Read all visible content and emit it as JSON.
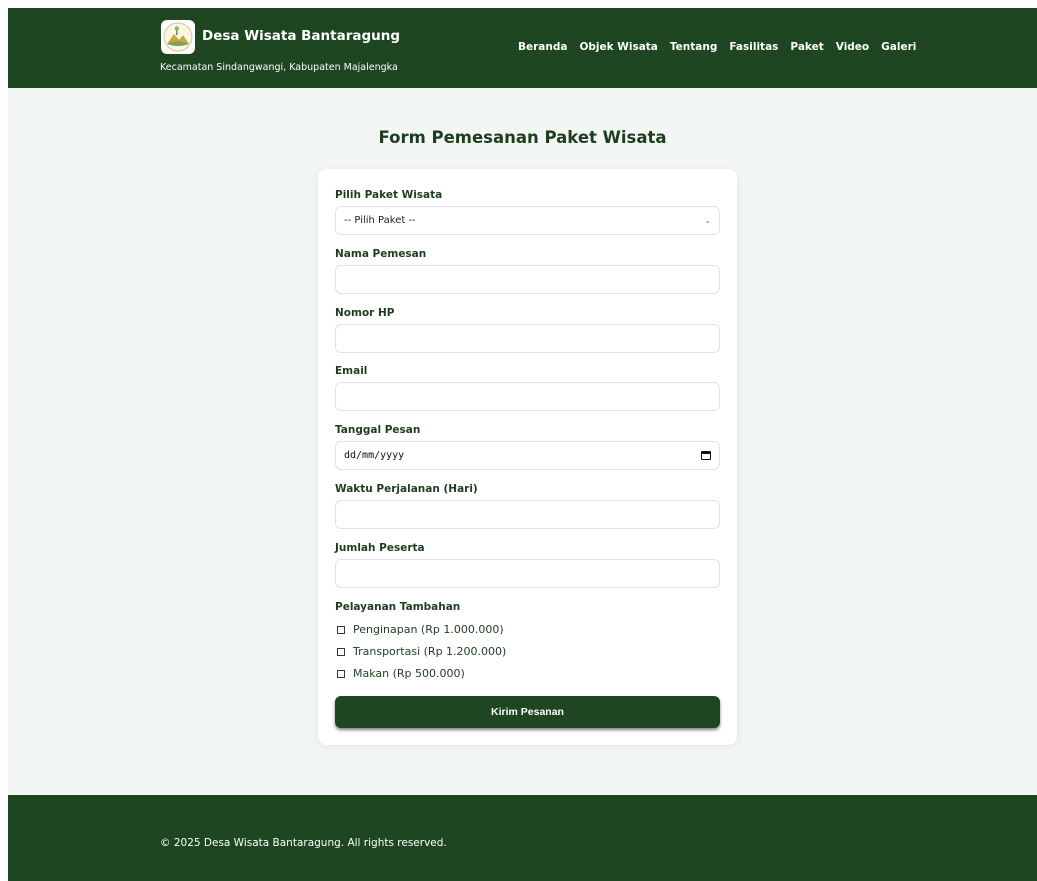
{
  "header": {
    "brand_title": "Desa Wisata Bantaragung",
    "brand_subtitle": "Kecamatan Sindangwangi, Kabupaten Majalengka",
    "nav": [
      "Beranda",
      "Objek Wisata",
      "Tentang",
      "Fasilitas",
      "Paket",
      "Video",
      "Galeri"
    ]
  },
  "form": {
    "title": "Form Pemesanan Paket Wisata",
    "paket_label": "Pilih Paket Wisata",
    "paket_selected": "-- Pilih Paket --",
    "nama_label": "Nama Pemesan",
    "nama_value": "",
    "hp_label": "Nomor HP",
    "hp_value": "",
    "email_label": "Email",
    "email_value": "",
    "tanggal_label": "Tanggal Pesan",
    "tanggal_placeholder": "dd/mm/yyyy",
    "waktu_label": "Waktu Perjalanan (Hari)",
    "waktu_value": "",
    "jumlah_label": "Jumlah Peserta",
    "jumlah_value": "",
    "layanan_label": "Pelayanan Tambahan",
    "layanan": [
      {
        "label": "Penginapan (Rp 1.000.000)",
        "checked": false
      },
      {
        "label": "Transportasi (Rp 1.200.000)",
        "checked": false
      },
      {
        "label": "Makan (Rp 500.000)",
        "checked": false
      }
    ],
    "submit_label": "Kirim Pesanan"
  },
  "footer": {
    "copyright": "© 2025 Desa Wisata Bantaragung. All rights reserved."
  },
  "colors": {
    "primary": "#1e4620",
    "page_bg": "#f3f7f3",
    "heading": "#1e3d20"
  }
}
